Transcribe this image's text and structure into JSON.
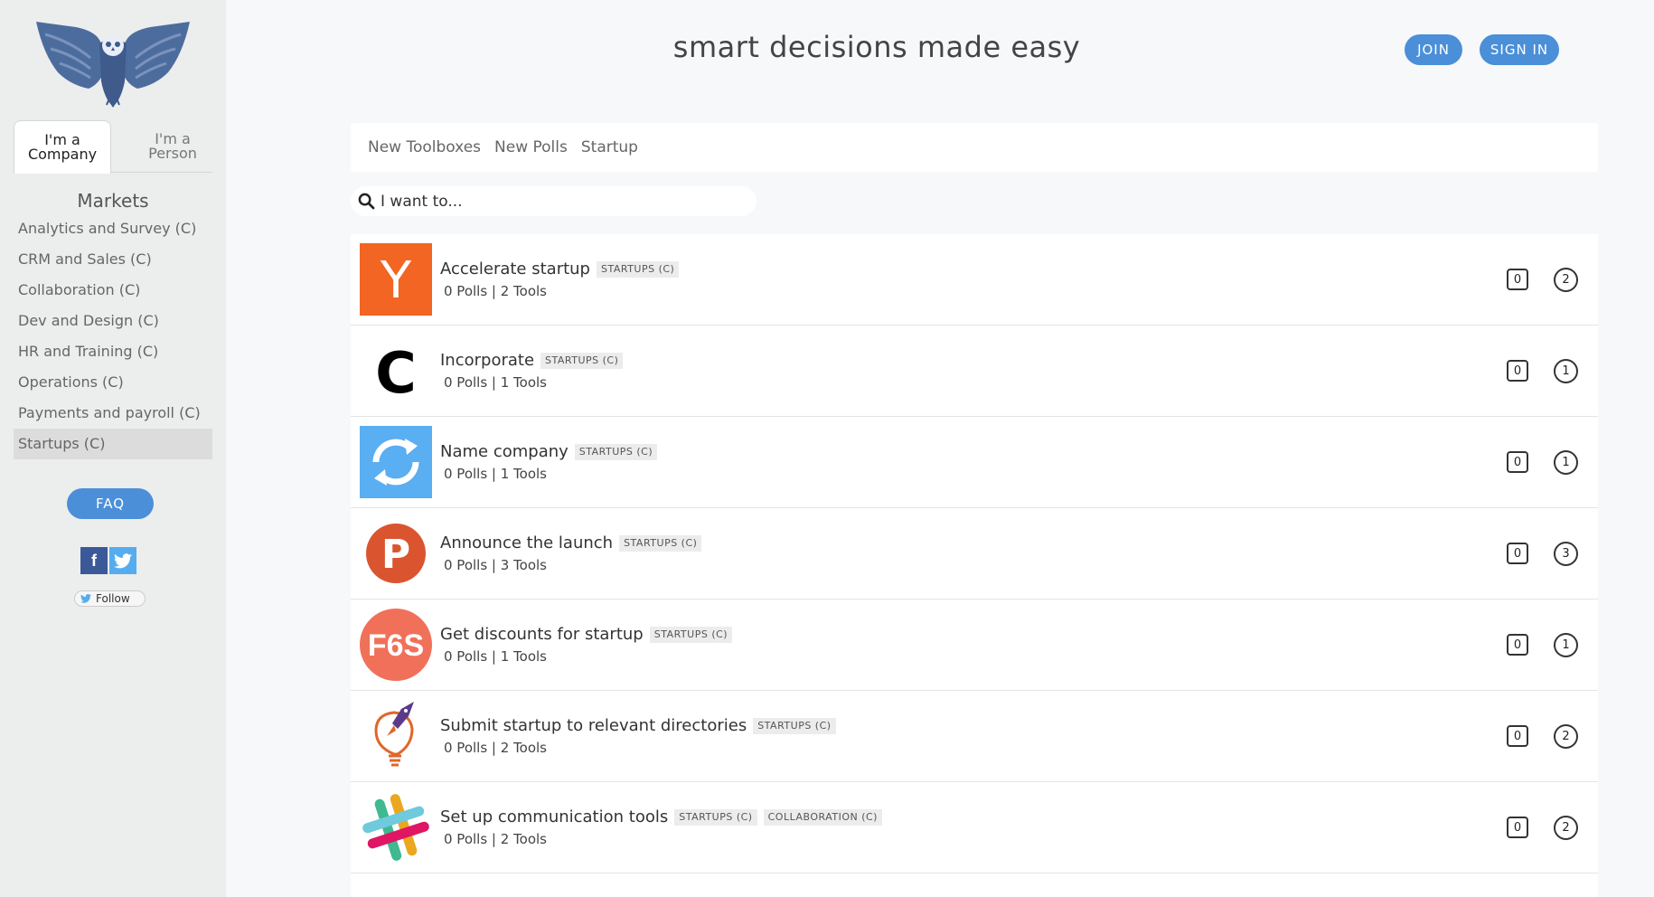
{
  "header": {
    "tagline": "smart decisions made easy",
    "join_label": "JOIN",
    "signin_label": "SIGN IN"
  },
  "colors": {
    "accent": "#4a8fd8",
    "sidebar_bg": "#eceded",
    "page_bg": "#f7f8fa"
  },
  "sidebar": {
    "persona_tabs": [
      {
        "line1": "I'm a",
        "line2": "Company",
        "active": true
      },
      {
        "line1": "I'm a",
        "line2": "Person",
        "active": false
      }
    ],
    "markets_title": "Markets",
    "markets": [
      "Analytics and Survey (C)",
      "CRM and Sales (C)",
      "Collaboration (C)",
      "Dev and Design (C)",
      "HR and Training (C)",
      "Operations (C)",
      "Payments and payroll (C)",
      "Startups (C)"
    ],
    "selected_market": "Startups (C)",
    "faq_label": "FAQ",
    "fb_glyph": "f",
    "follow_label": "Follow"
  },
  "filters": [
    "New Toolboxes",
    "New Polls",
    "Startup"
  ],
  "search": {
    "placeholder": "I want to..."
  },
  "rows": [
    {
      "title": "Accelerate startup",
      "tags": [
        "STARTUPS (C)"
      ],
      "meta": "0 Polls | 2 Tools",
      "count_a": "0",
      "count_b": "2",
      "icon": "ycombinator-logo-icon"
    },
    {
      "title": "Incorporate",
      "tags": [
        "STARTUPS (C)"
      ],
      "meta": "0 Polls | 1 Tools",
      "count_a": "0",
      "count_b": "1",
      "icon": "clerky-logo-icon"
    },
    {
      "title": "Name company",
      "tags": [
        "STARTUPS (C)"
      ],
      "meta": "0 Polls | 1 Tools",
      "count_a": "0",
      "count_b": "1",
      "icon": "refresh-logo-icon"
    },
    {
      "title": "Announce the launch",
      "tags": [
        "STARTUPS (C)"
      ],
      "meta": "0 Polls | 3 Tools",
      "count_a": "0",
      "count_b": "3",
      "icon": "producthunt-logo-icon"
    },
    {
      "title": "Get discounts for startup",
      "tags": [
        "STARTUPS (C)"
      ],
      "meta": "0 Polls | 1 Tools",
      "count_a": "0",
      "count_b": "1",
      "icon": "f6s-logo-icon"
    },
    {
      "title": "Submit startup to relevant directories",
      "tags": [
        "STARTUPS (C)"
      ],
      "meta": "0 Polls | 2 Tools",
      "count_a": "0",
      "count_b": "2",
      "icon": "rocket-bulb-logo-icon"
    },
    {
      "title": "Set up communication tools",
      "tags": [
        "STARTUPS (C)",
        "COLLABORATION (C)"
      ],
      "meta": "0 Polls | 2 Tools",
      "count_a": "0",
      "count_b": "2",
      "icon": "slack-logo-icon"
    }
  ],
  "logo_text": {
    "ycombinator": "Y",
    "clerky": "C",
    "producthunt": "P",
    "f6s": "F6S"
  }
}
